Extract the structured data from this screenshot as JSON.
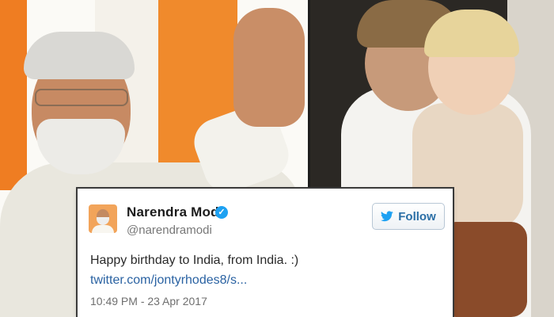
{
  "tweet": {
    "display_name": "Narendra Modi",
    "handle": "@narendramodi",
    "follow_label": "Follow",
    "text": "Happy birthday to India, from India. :)",
    "link": "twitter.com/jontyrhodes8/s...",
    "timestamp": "10:49 PM - 23 Apr 2017",
    "verified_icon": "verified-check-icon",
    "bird_icon": "twitter-bird-icon",
    "brand_color": "#1da1f2"
  }
}
